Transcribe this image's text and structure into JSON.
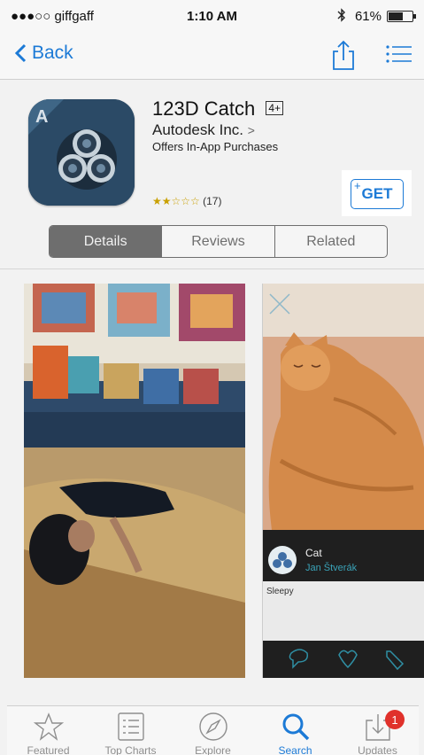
{
  "status_bar": {
    "carrier": "●●●○○ giffgaff",
    "time": "1:10 AM",
    "battery": "61%"
  },
  "nav": {
    "back_label": "Back"
  },
  "app": {
    "title": "123D Catch",
    "age_rating": "4+",
    "developer": "Autodesk Inc.",
    "developer_chevron": ">",
    "iap_note": "Offers In-App Purchases",
    "rating_stars": "★★☆☆☆",
    "rating_count": "(17)",
    "get_label": "GET",
    "get_plus": "+"
  },
  "segments": [
    "Details",
    "Reviews",
    "Related"
  ],
  "screenshot_cat": {
    "name": "Cat",
    "user": "Jan Štverák",
    "description": "Sleepy"
  },
  "tabs": [
    {
      "label": "Featured",
      "icon": "star-icon"
    },
    {
      "label": "Top Charts",
      "icon": "list-icon"
    },
    {
      "label": "Explore",
      "icon": "compass-icon"
    },
    {
      "label": "Search",
      "icon": "search-icon"
    },
    {
      "label": "Updates",
      "icon": "download-icon",
      "badge": "1"
    }
  ],
  "colors": {
    "accent": "#1c7ad6",
    "badge": "#e0312b"
  }
}
